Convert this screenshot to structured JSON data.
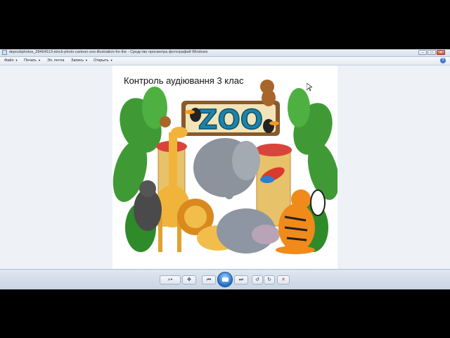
{
  "window": {
    "title": "depositphotos_28464513-stock-photo-cartoon-zoo-illustration-for-the - Средство просмотра фотографий Windows"
  },
  "menu": {
    "file": "Файл",
    "print": "Печать",
    "email": "Эл. почта",
    "burn": "Запись",
    "open": "Открыть"
  },
  "photo": {
    "caption": "Контроль аудіювання 3 клас",
    "sign": "ZOO"
  },
  "colors": {
    "sign_blue": "#1d83a8",
    "sign_frame": "#8a5a2b",
    "jungle_green": "#3f9a35",
    "titlebar": "#dde5ef"
  },
  "icons": {
    "zoom": "magnifier-icon",
    "fit": "actual-size-icon",
    "prev": "previous-icon",
    "slideshow": "slideshow-icon",
    "next": "next-icon",
    "rotate_ccw": "rotate-left-icon",
    "rotate_cw": "rotate-right-icon",
    "delete": "delete-icon"
  }
}
